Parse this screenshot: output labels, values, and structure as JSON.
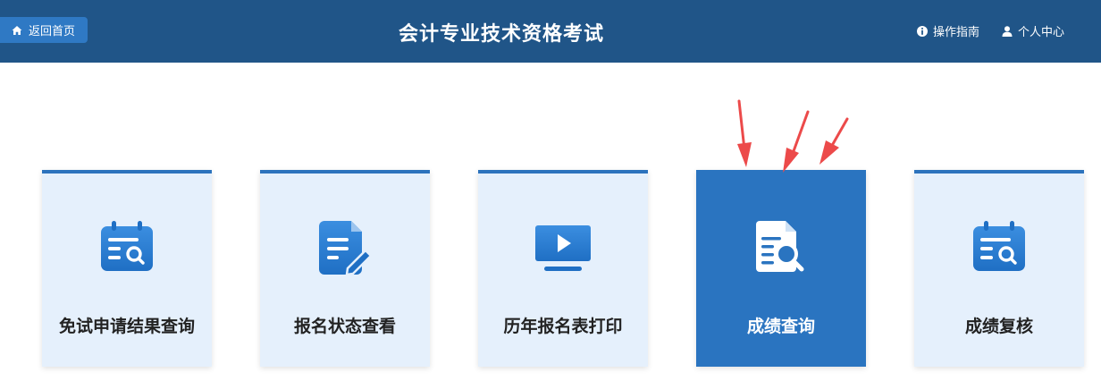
{
  "header": {
    "home_label": "返回首页",
    "title": "会计专业技术资格考试",
    "guide_label": "操作指南",
    "user_center_label": "个人中心"
  },
  "cards": [
    {
      "label": "免试申请结果查询",
      "icon": "calendar-search-icon",
      "active": false
    },
    {
      "label": "报名状态查看",
      "icon": "document-edit-icon",
      "active": false
    },
    {
      "label": "历年报名表打印",
      "icon": "monitor-play-icon",
      "active": false
    },
    {
      "label": "成绩查询",
      "icon": "document-search-icon",
      "active": true
    },
    {
      "label": "成绩复核",
      "icon": "calendar-search-icon",
      "active": false
    }
  ],
  "colors": {
    "header_bg": "#205588",
    "accent": "#2a74c0",
    "card_bg": "#e5f0fc",
    "arrow": "#ec4a4a"
  }
}
